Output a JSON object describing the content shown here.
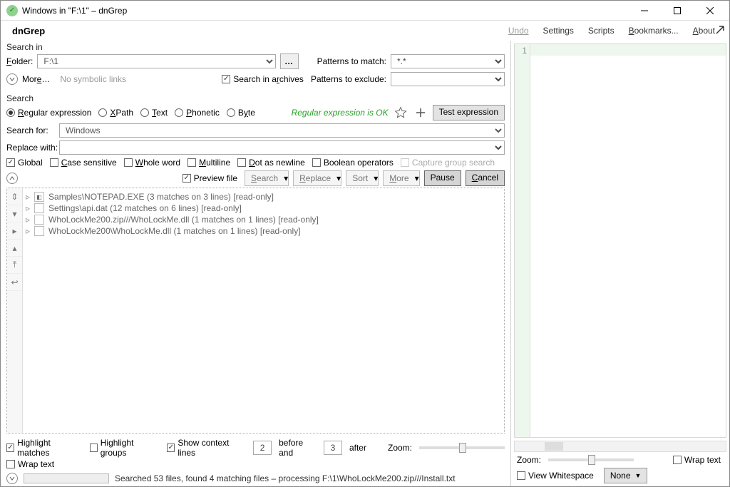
{
  "title": "Windows in \"F:\\1\" – dnGrep",
  "menu": {
    "app": "dnGrep",
    "undo": "Undo",
    "settings": "Settings",
    "scripts": "Scripts",
    "bookmarks": "Bookmarks...",
    "about": "About"
  },
  "search_in": {
    "heading": "Search in",
    "folder_label": "Folder:",
    "folder_value": "F:\\1",
    "more": "More…",
    "no_symlinks": "No symbolic links",
    "search_in_archives": "Search in archives",
    "patterns_match_label": "Patterns to match:",
    "patterns_match_value": "*.*",
    "patterns_exclude_label": "Patterns to exclude:",
    "patterns_exclude_value": ""
  },
  "search": {
    "heading": "Search",
    "radios": {
      "regex": "Regular expression",
      "xpath": "XPath",
      "text": "Text",
      "phonetic": "Phonetic",
      "byte": "Byte"
    },
    "status": "Regular expression is OK",
    "test_btn": "Test expression",
    "search_for_label": "Search for:",
    "search_for_value": "Windows",
    "replace_with_label": "Replace with:",
    "replace_with_value": "",
    "opts": {
      "global": "Global",
      "case": "Case sensitive",
      "whole": "Whole word",
      "multiline": "Multiline",
      "dot": "Dot as newline",
      "bool": "Boolean operators",
      "capture": "Capture group search"
    }
  },
  "toolbar": {
    "preview_file": "Preview file",
    "search": "Search",
    "replace": "Replace",
    "sort": "Sort",
    "more": "More",
    "pause": "Pause",
    "cancel": "Cancel"
  },
  "results": [
    "Samples\\NOTEPAD.EXE (3 matches on 3 lines) [read-only]",
    "Settings\\api.dat (12 matches on 6 lines) [read-only]",
    "WhoLockMe200.zip///WhoLockMe.dll (1 matches on 1 lines) [read-only]",
    "WhoLockMe200\\WhoLockMe.dll (1 matches on 1 lines) [read-only]"
  ],
  "bottom": {
    "highlight_matches": "Highlight matches",
    "highlight_groups": "Highlight groups",
    "show_context": "Show context lines",
    "before_val": "2",
    "before_and": "before and",
    "after_val": "3",
    "after": "after",
    "zoom": "Zoom:",
    "wrap_text": "Wrap text"
  },
  "status": "Searched 53 files, found 4 matching files – processing F:\\1\\WhoLockMe200.zip///Install.txt",
  "preview": {
    "line_no": "1",
    "zoom_label": "Zoom:",
    "wrap_text": "Wrap text",
    "view_whitespace": "View Whitespace",
    "none": "None"
  }
}
